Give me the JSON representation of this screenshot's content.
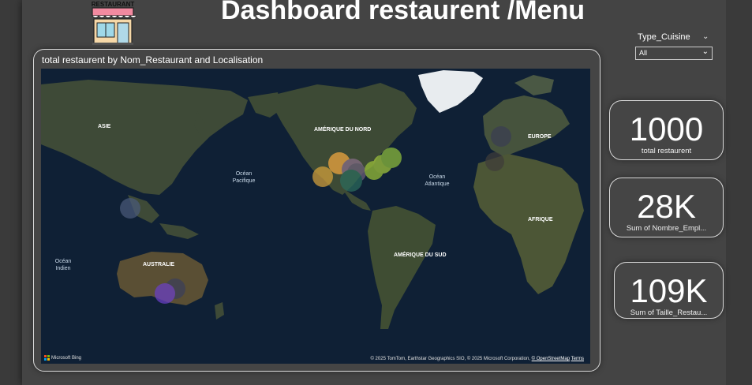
{
  "header": {
    "title": "Dashboard restaurent /Menu",
    "logo_text": "RESTAURANT"
  },
  "slicer": {
    "label": "Type_Cuisine",
    "selected": "All"
  },
  "map": {
    "title": "total restaurent by Nom_Restaurant and Localisation",
    "labels": {
      "asia": "ASIE",
      "pacific": "Océan\nPacifique",
      "north_america": "AMÉRIQUE DU NORD",
      "atlantic": "Océan\nAtlantique",
      "europe": "EUROPE",
      "africa": "AFRIQUE",
      "south_america": "AMÉRIQUE DU SUD",
      "australia": "AUSTRALIE",
      "indian": "Océan\nIndien"
    },
    "provider": "Microsoft Bing",
    "credit": "© 2025 TomTom, Earthstar Geographics SIO, © 2025 Microsoft Corporation,",
    "credit_link": "© OpenStreetMap",
    "terms": "Terms",
    "colors": {
      "ocean": "#0f2035",
      "land": "#3d4a35",
      "ice": "#e8ecef"
    }
  },
  "kpis": [
    {
      "value": "1000",
      "label": "total restaurent"
    },
    {
      "value": "28K",
      "label": "Sum of Nombre_Empl..."
    },
    {
      "value": "109K",
      "label": "Sum of Taille_Restau..."
    }
  ]
}
